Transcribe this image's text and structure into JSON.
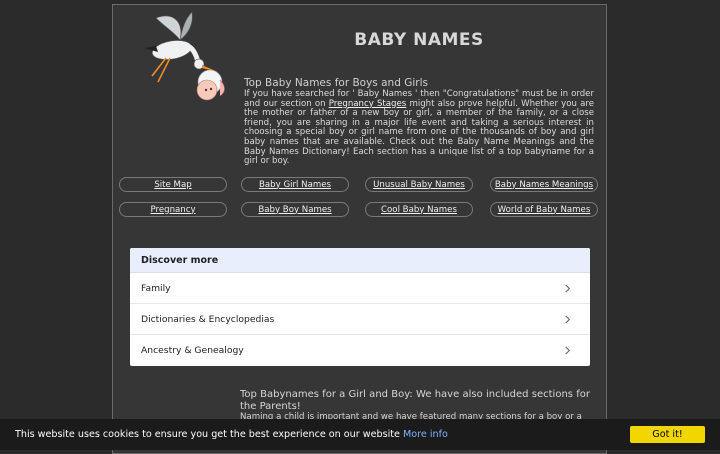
{
  "header": {
    "site_title": "BABY NAMES",
    "logo_icon": "stork-with-baby-logo"
  },
  "intro": {
    "title": "Top Baby Names for Boys and Girls",
    "text_1": "If you have searched for ' Baby Names ' then \"Congratulations\" must be in order and our section on ",
    "link": "Pregnancy Stages",
    "text_2": " might also prove helpful. Whether you are the mother or father of a new boy or girl, a member of the family, or a close friend, you are sharing in a major life event  and taking a serious interest in choosing a special boy or girl name from one of the thousands of boy and girl baby names that are available. Check out the Baby Name Meanings and the Baby Names Dictionary! Each section has a unique list of a top babyname for a girl or boy."
  },
  "nav": {
    "row1": [
      "Site Map",
      "Baby Girl Names",
      "Unusual Baby Names",
      "Baby Names Meanings"
    ],
    "row2": [
      "Pregnancy",
      "Baby Boy Names",
      "Cool Baby Names",
      "World of Baby Names"
    ]
  },
  "discover": {
    "header": "Discover more",
    "items": [
      "Family",
      "Dictionaries & Encyclopedias",
      "Ancestry & Genealogy"
    ],
    "chevron_icon": "chevron-right-icon"
  },
  "bottom": {
    "title": "Top Babynames for a Girl and Boy: We have also included sections for the Parents!",
    "body": "Naming a child is important and we have featured many sections for a boy or a girl"
  },
  "cookie": {
    "message": "This website uses cookies to ensure you get the best experience on our website",
    "more_info": "More info",
    "button": "Got it!",
    "accent": "#f1d600"
  }
}
